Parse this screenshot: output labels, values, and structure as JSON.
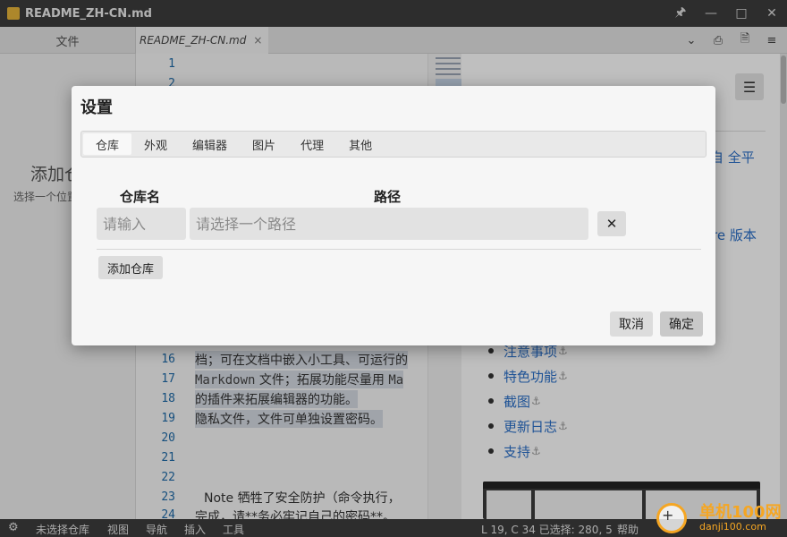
{
  "window": {
    "title": "README_ZH-CN.md",
    "buttons": [
      "pin",
      "minimize",
      "maximize",
      "close"
    ]
  },
  "tabs_bar": {
    "files_label": "文件",
    "doc_tab_label": "README_ZH-CN.md",
    "doc_tab_close": "×"
  },
  "sidepanel": {
    "add_title": "添加仓库",
    "add_subtitle": "选择一个位置"
  },
  "editor": {
    "line_numbers": [
      "1",
      "2",
      "16",
      "17",
      "18",
      "19",
      "20",
      "21",
      "22",
      "23",
      "24"
    ],
    "lines": {
      "l16": "档；可在文档中嵌入小工具、可运行的",
      "l17_a": "Markdown",
      "l17_b": " 文件；拓展功能尽量用 ",
      "l17_c": "Ma",
      "l18": "的插件来拓展编辑器的功能。",
      "l19": "隐私文件，文件可单独设置密码。",
      "l23": "Note 牺牲了安全防护（命令执行，",
      "l24": "完成，请**务必牢记自己的密码**。"
    }
  },
  "preview": {
    "partial_1": "自 全平",
    "partial_2": "re 版本",
    "toc": [
      {
        "label": "注意事项",
        "anchor": "⚓"
      },
      {
        "label": "特色功能",
        "anchor": "⚓"
      },
      {
        "label": "截图",
        "anchor": "⚓"
      },
      {
        "label": "更新日志",
        "anchor": "⚓"
      },
      {
        "label": "支持",
        "anchor": "⚓"
      }
    ]
  },
  "statusbar": {
    "menu": [
      "未选择仓库",
      "视图",
      "导航",
      "插入",
      "工具"
    ],
    "cursor": "L 19, C 34 已选择: 280, 5",
    "help": "帮助"
  },
  "dialog": {
    "title": "设置",
    "tabs": [
      "仓库",
      "外观",
      "编辑器",
      "图片",
      "代理",
      "其他"
    ],
    "active_tab": "仓库",
    "col_name": "仓库名",
    "col_path": "路径",
    "name_placeholder": "请输入",
    "path_placeholder": "请选择一个路径",
    "clear_label": "✕",
    "add_repo_label": "添加仓库",
    "cancel_label": "取消",
    "ok_label": "确定"
  },
  "watermark": {
    "text": "单机100网",
    "url": "danji100.com"
  },
  "colors": {
    "titlebar": "#3c3c3c",
    "link": "#2a6fc9",
    "line_number": "#1e6aa8",
    "watermark": "#f5a623"
  }
}
